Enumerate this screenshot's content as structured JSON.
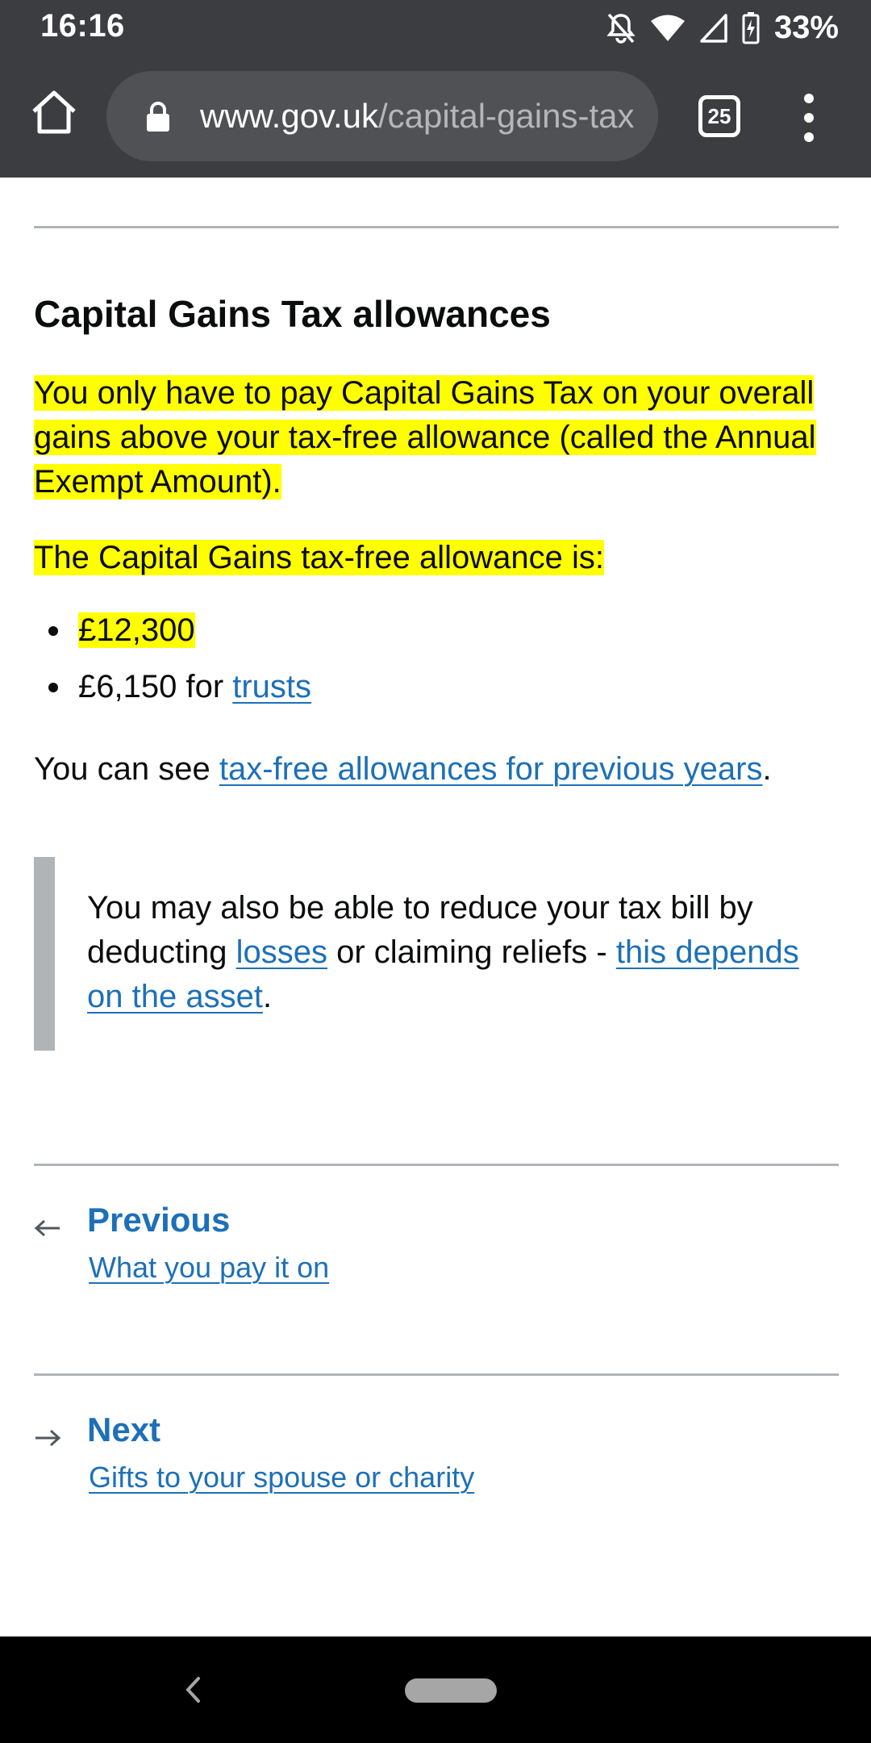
{
  "status_bar": {
    "time": "16:16",
    "battery": "33%",
    "icons": [
      "notifications-off-icon",
      "wifi-icon",
      "signal-icon",
      "battery-charging-icon"
    ]
  },
  "browser": {
    "url_domain": "www.gov.uk",
    "url_path": "/capital-gains-tax",
    "tab_count": "25",
    "icons": [
      "home-icon",
      "lock-icon",
      "more-vert-icon"
    ]
  },
  "content": {
    "heading": "Capital Gains Tax allowances",
    "intro": "You only have to pay Capital Gains Tax on your overall gains above your tax-free allowance (called the Annual Exempt Amount).",
    "allowance_intro": "The Capital Gains tax-free allowance is:",
    "bullet_1": "£12,300",
    "bullet_2_text": "£6,150 for ",
    "bullet_2_link": "trusts",
    "prev_years_text": "You can see ",
    "prev_years_link": "tax-free allowances for previous years",
    "prev_years_end": ".",
    "inset": {
      "text_1": "You may also be able to reduce your tax bill by deducting ",
      "link_1": "losses",
      "text_2": " or claiming reliefs - ",
      "link_2": "this depends on the asset",
      "text_3": "."
    }
  },
  "pagination": {
    "previous_label": "Previous",
    "previous_title": "What you pay it on",
    "next_label": "Next",
    "next_title": "Gifts to your spouse or charity"
  },
  "colors": {
    "link": "#1d70b8",
    "highlight": "#ffff00",
    "chrome": "#3c3d41"
  }
}
